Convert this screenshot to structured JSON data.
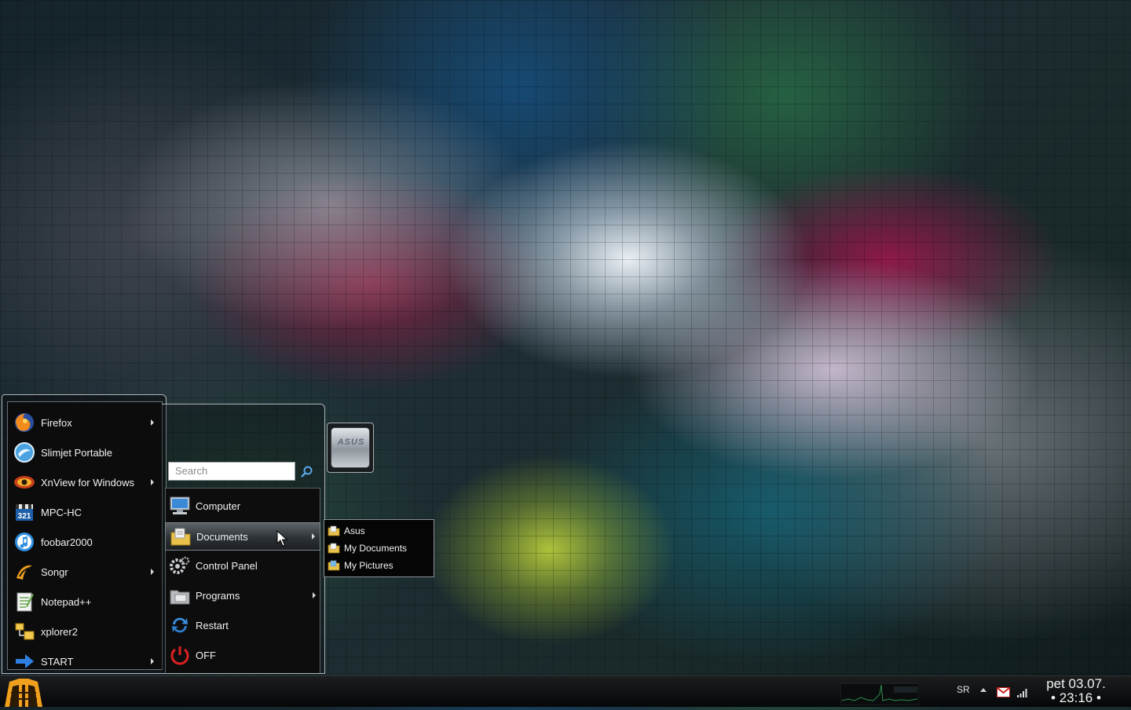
{
  "start_menu": {
    "left_items": [
      {
        "label": "Firefox",
        "icon": "firefox-icon",
        "has_submenu": true
      },
      {
        "label": "Slimjet Portable",
        "icon": "slimjet-icon",
        "has_submenu": false
      },
      {
        "label": "XnView for Windows",
        "icon": "xnview-icon",
        "has_submenu": true
      },
      {
        "label": "MPC-HC",
        "icon": "mpc-hc-icon",
        "has_submenu": false
      },
      {
        "label": "foobar2000",
        "icon": "foobar2000-icon",
        "has_submenu": false
      },
      {
        "label": "Songr",
        "icon": "songr-icon",
        "has_submenu": true
      },
      {
        "label": "Notepad++",
        "icon": "notepadpp-icon",
        "has_submenu": false
      },
      {
        "label": "xplorer2",
        "icon": "xplorer2-icon",
        "has_submenu": false
      },
      {
        "label": "START",
        "icon": "arrow-right-icon",
        "has_submenu": true
      }
    ],
    "search": {
      "placeholder": "Search"
    },
    "user_picture_text": "ASUS",
    "right_items": [
      {
        "label": "Computer",
        "icon": "computer-icon",
        "has_submenu": false
      },
      {
        "label": "Documents",
        "icon": "documents-icon",
        "has_submenu": true,
        "highlighted": true
      },
      {
        "label": "Control Panel",
        "icon": "control-panel-icon",
        "has_submenu": false
      },
      {
        "label": "Programs",
        "icon": "programs-icon",
        "has_submenu": true
      },
      {
        "label": "Restart",
        "icon": "restart-icon",
        "has_submenu": false
      },
      {
        "label": "OFF",
        "icon": "power-icon",
        "has_submenu": false
      }
    ],
    "documents_submenu": [
      {
        "label": "Asus"
      },
      {
        "label": "My Documents"
      },
      {
        "label": "My Pictures"
      }
    ]
  },
  "taskbar": {
    "language": "SR",
    "clock_line1": "pet 03.07.",
    "clock_line2": "• 23:16 •"
  },
  "colors": {
    "accent_orange": "#f0a01c",
    "power_red": "#e02020",
    "menu_bg": "#0c0c0c"
  }
}
